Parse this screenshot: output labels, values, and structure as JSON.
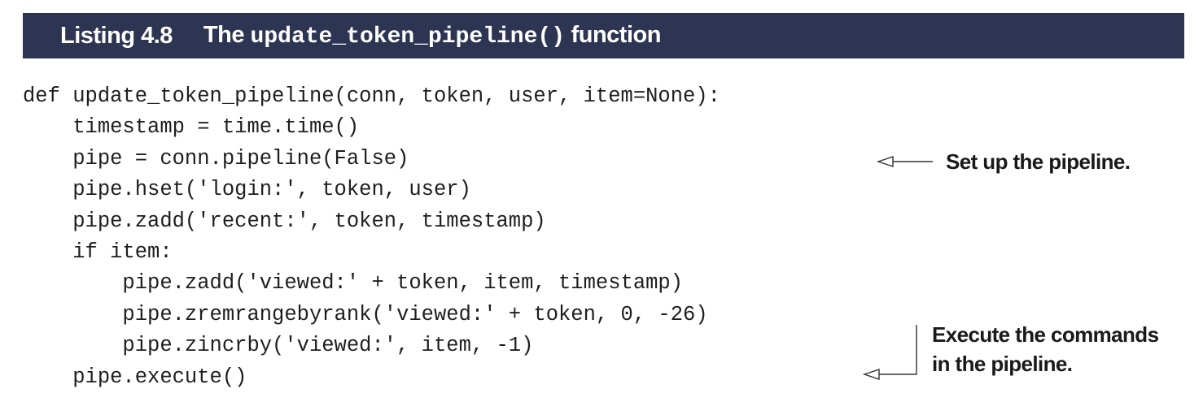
{
  "listing": {
    "number": "Listing 4.8",
    "title_prefix": "The",
    "title_code": "update_token_pipeline()",
    "title_suffix": "function"
  },
  "code_lines": [
    "def update_token_pipeline(conn, token, user, item=None):",
    "    timestamp = time.time()",
    "    pipe = conn.pipeline(False)",
    "    pipe.hset('login:', token, user)",
    "    pipe.zadd('recent:', token, timestamp)",
    "    if item:",
    "        pipe.zadd('viewed:' + token, item, timestamp)",
    "        pipe.zremrangebyrank('viewed:' + token, 0, -26)",
    "        pipe.zincrby('viewed:', item, -1)",
    "    pipe.execute()"
  ],
  "annotations": {
    "setup": "Set up the pipeline.",
    "execute_line1": "Execute the commands",
    "execute_line2": "in the pipeline."
  },
  "colors": {
    "header_background": "#2e3553",
    "header_text": "#ffffff",
    "code_text": "#1e1e1e"
  }
}
